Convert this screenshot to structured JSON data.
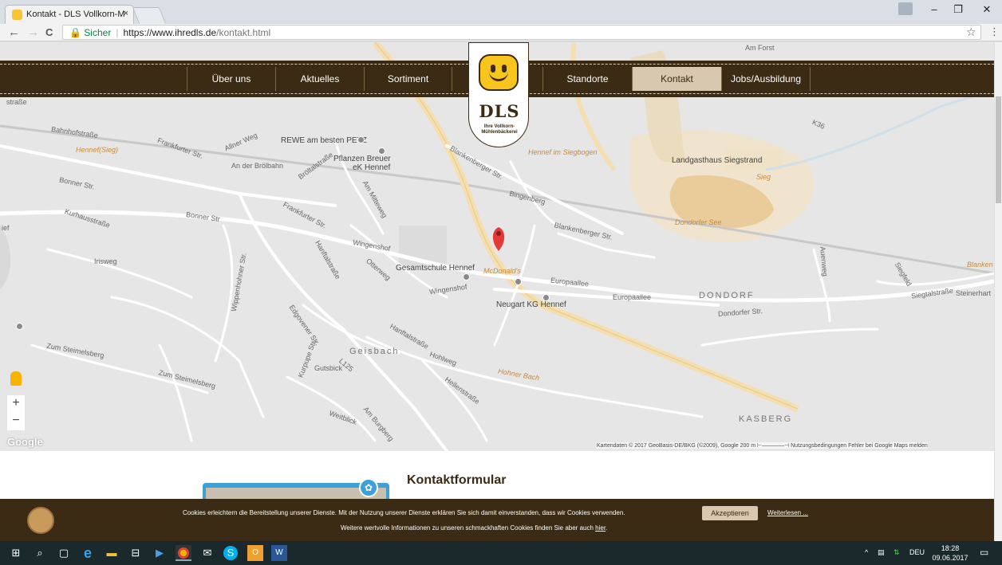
{
  "browser": {
    "tab_title": "Kontakt - DLS Vollkorn-M",
    "tab_close": "×",
    "back": "←",
    "forward": "→",
    "reload": "C",
    "secure_label": "Sicher",
    "url_domain": "https://www.ihredls.de",
    "url_path": "/kontakt.html",
    "bookmark": "☆",
    "menu": "⋮",
    "win_min": "–",
    "win_max": "❐",
    "win_close": "✕"
  },
  "nav": {
    "items": [
      {
        "label": "Über uns"
      },
      {
        "label": "Aktuelles"
      },
      {
        "label": "Sortiment"
      },
      {
        "label": "Standorte"
      },
      {
        "label": "Kontakt"
      },
      {
        "label": "Jobs/Ausbildung"
      }
    ],
    "active": "Kontakt"
  },
  "logo": {
    "text": "DLS",
    "subtitle": "Ihre Vollkorn-\nMühlenbäckerei"
  },
  "map": {
    "labels": {
      "bahnhofstrasse": "Bahnhofstraße",
      "hennef_sieg": "Hennef(Sieg)",
      "rewe": "REWE am besten PETZ",
      "an_der_broelbahn": "An der Brölbahn",
      "pflanzen": "Pflanzen Breuer",
      "pflanzen2": "eK Hennef",
      "hennef_siegbogen": "Hennef im Siegbogen",
      "landgasthaus": "Landgasthaus Siegstrand",
      "sieg": "Sieg",
      "dondorfer_see": "Dondorfer See",
      "bonner_str": "Bonner Str.",
      "bonner_str2": "Bonner Str",
      "kurhausstrasse": "Kurhausstraße",
      "frankfurter": "Frankfurter Str.",
      "frankfurter2": "Frankfurter Str.",
      "wingenshof": "Wingenshof",
      "gesamtschule": "Gesamtschule Hennef",
      "mcdonalds": "McDonald's",
      "europaallee": "Europaallee",
      "europaallee2": "Europaallee",
      "neugart": "Neugart KG Hennef",
      "dondorf": "DONDORF",
      "dondorfer_str": "Dondorfer Str.",
      "siegtalstrasse": "Siegtalstraße",
      "geisbach": "Geisbach",
      "hanftalstrasse": "Hanftalstraße",
      "hohner_bach": "Hohner Bach",
      "kasberg": "KASBERG",
      "zum_steimelsberg": "Zum Steimelsberg",
      "zum_steimelsberg2": "Zum Steimelsberg",
      "blankenberger": "Blankenberger Str.",
      "blankenberger2": "Blankenberger Str.",
      "bingenberg": "Bingenberg",
      "am_mitteweg": "Am Mitteweg",
      "hanftalstr2": "Hanftalstraße",
      "otterweg": "Otterweg",
      "edgovener": "Edgovener Str.",
      "gutsbick": "Gutsbick",
      "kurpuppe": "Kurpupe Str.",
      "wippenhohner": "Wippenhohner Str.",
      "hohlweg": "Hohlweg",
      "hellenstrasse": "Hellenstraße",
      "weitblick": "Weitblick",
      "am_burgberg": "Am Burgberg",
      "l125": "L125",
      "wingenshof2": "Wingenshof",
      "broelstrasse": "Bröltalstraße",
      "auenweg": "Auenweg",
      "siegfeld": "Siegfeld",
      "blanken": "Blanken",
      "steinerhart": "Steinerhart",
      "k36": "K36",
      "am_forst": "Am Forst",
      "ief": "ief",
      "strasse": "straße",
      "irisweg": "Irisweg",
      "alner_weg": "Allner Weg"
    },
    "controls": {
      "zoom_in": "+",
      "zoom_out": "−"
    },
    "google": "Google",
    "attribution": "Kartendaten © 2017 GeoBasis-DE/BKG (©2009), Google   200 m ⊢————⊣   Nutzungsbedingungen   Fehler bei Google Maps melden",
    "colors": {
      "background": "#e6e6e6",
      "major_road": "#f5dfb0",
      "marker": "#e53935"
    }
  },
  "contact": {
    "title": "Kontaktformular"
  },
  "cookie": {
    "line1": "Cookies erleichtern die Bereitstellung unserer Dienste. Mit der Nutzung unserer Dienste erklären Sie sich damit einverstanden, dass wir Cookies verwenden.",
    "accept": "Akzeptieren",
    "more": "Weiterlesen ...",
    "line2_prefix": "Weitere wertvolle Informationen zu unseren schmackhaften Cookies finden Sie aber auch ",
    "line2_link": "hier",
    "line2_suffix": "."
  },
  "taskbar": {
    "lang": "DEU",
    "time": "18:28",
    "date": "09.06.2017",
    "tray_arrow": "^"
  },
  "colors": {
    "brand_brown": "#3b2a14",
    "brand_beige": "#d8c8b0",
    "logo_yellow": "#f7c51e"
  }
}
